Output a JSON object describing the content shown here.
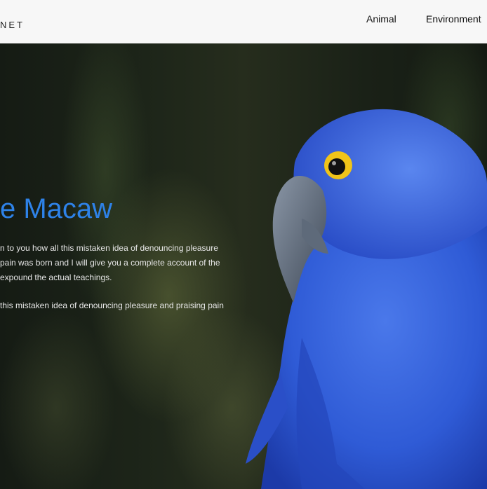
{
  "header": {
    "brand": "NET",
    "nav": [
      {
        "label": "Animal"
      },
      {
        "label": "Environment"
      }
    ]
  },
  "hero": {
    "title": "e Macaw",
    "paragraph1_line1": "n to you how all this mistaken idea of denouncing pleasure",
    "paragraph1_line2": " pain was born and I will give you a complete account of the",
    "paragraph1_line3": " expound the actual teachings.",
    "paragraph2": "this mistaken idea of denouncing pleasure and praising pain",
    "image": "blue-macaw-photo"
  },
  "colors": {
    "title": "#2e82e8",
    "header_bg": "#f7f7f7",
    "parrot_blue": "#2f5bd6"
  }
}
